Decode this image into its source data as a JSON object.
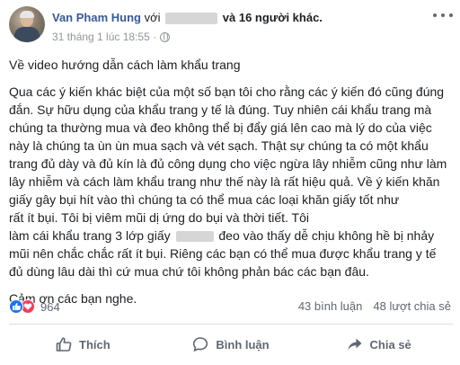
{
  "header": {
    "author": "Van Pham Hung",
    "with_text": "với",
    "others_text": "và 16 người khác.",
    "timestamp": "31 tháng 1 lúc 18:55 ·"
  },
  "post": {
    "paragraphs": [
      [
        "Về video hướng dẫn cách làm khẩu trang"
      ],
      [
        "Qua các ý kiến khác biệt của một số bạn tôi cho rằng các ý kiến đó cũng đúng",
        "đắn. Sự hữu dụng của khẩu trang y tế là đúng. Tuy nhiên cái khẩu trang mà",
        "chúng ta thường mua và đeo không thể bị đẩy giá lên cao mà lý do của việc",
        "này là chúng ta ùn ùn mua sạch và vét sạch. Thật sự chúng ta có một khẩu",
        "trang đủ dày và đủ kín là đủ công dụng cho việc ngừa lây nhiễm cũng như làm",
        "lây nhiễm và cách làm khẩu trang như thế này là rất hiệu quả. Về ý kiến khăn",
        "giấy gây bụi hít vào thì chúng ta có thể mua các loại khăn giấy tốt như"
      ],
      [],
      [
        "Cảm ơn các bạn nghe."
      ]
    ],
    "line8_after_blur": "rất ít bụi. Tôi bị viêm mũi dị ứng do bụi và thời tiết. Tôi",
    "line9_before_blur": "làm cái khẩu trang 3 lớp giấy",
    "line9_after_blur": "đeo vào thấy dễ chịu không hề bị nhảy",
    "line10": "mũi nên chắc chắc rất ít bụi. Riêng các bạn có thể mua được khẩu trang y tế",
    "line11": "đủ dùng lâu dài thì cứ mua chứ tôi không phản bác các bạn đâu."
  },
  "stats": {
    "reaction_count": "964",
    "comments": "43 bình luận",
    "shares": "48 lượt chia sẻ"
  },
  "actions": {
    "like": "Thích",
    "comment": "Bình luận",
    "share": "Chia sẻ"
  },
  "icons": {
    "like_color": "#1877f2",
    "love_color": "#f33e58"
  }
}
